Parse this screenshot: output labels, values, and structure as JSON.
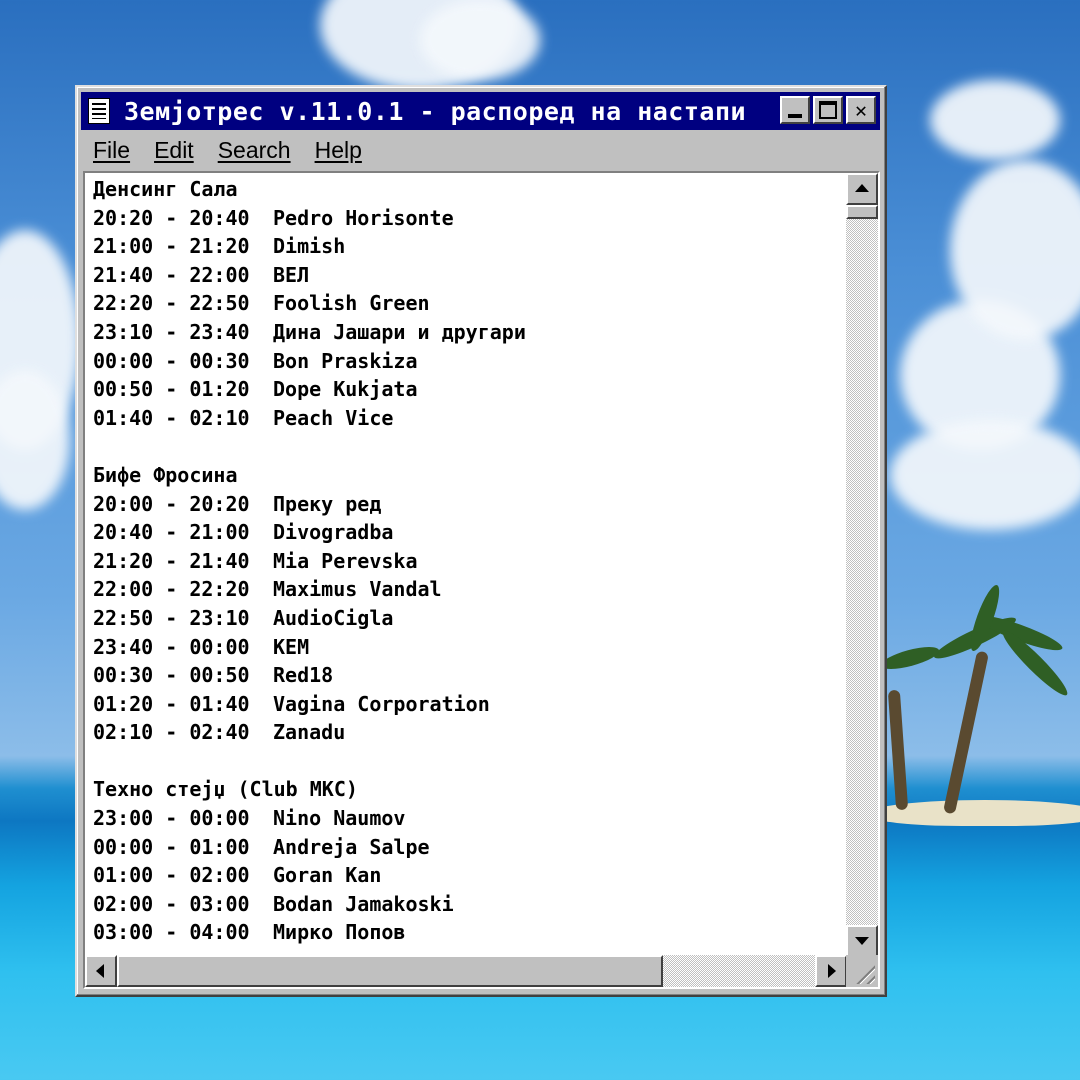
{
  "window": {
    "title": "Земјотрес v.11.0.1 - распоред на настапи"
  },
  "menu": [
    "File",
    "Edit",
    "Search",
    "Help"
  ],
  "content": {
    "lines": [
      {
        "text": "Денсинг Сала"
      },
      {
        "time": "20:20 - 20:40",
        "act": "Pedro Horisonte"
      },
      {
        "time": "21:00 - 21:20",
        "act": "Dimish"
      },
      {
        "time": "21:40 - 22:00",
        "act": "ВЕЛ"
      },
      {
        "time": "22:20 - 22:50",
        "act": "Foolish Green"
      },
      {
        "time": "23:10 - 23:40",
        "act": "Дина Јашари и другари"
      },
      {
        "time": "00:00 - 00:30",
        "act": "Bon Praskiza"
      },
      {
        "time": "00:50 - 01:20",
        "act": "Dope Kukjata"
      },
      {
        "time": "01:40 - 02:10",
        "act": "Peach Vice"
      },
      {
        "text": ""
      },
      {
        "text": "Бифе Фросина"
      },
      {
        "time": "20:00 - 20:20",
        "act": "Преку ред"
      },
      {
        "time": "20:40 - 21:00",
        "act": "Divogradba"
      },
      {
        "time": "21:20 - 21:40",
        "act": "Mia Perevska"
      },
      {
        "time": "22:00 - 22:20",
        "act": "Maximus Vandal"
      },
      {
        "time": "22:50 - 23:10",
        "act": "AudioCigla"
      },
      {
        "time": "23:40 - 00:00",
        "act": "KEM"
      },
      {
        "time": "00:30 - 00:50",
        "act": "Red18"
      },
      {
        "time": "01:20 - 01:40",
        "act": "Vagina Corporation"
      },
      {
        "time": "02:10 - 02:40",
        "act": "Zanadu"
      },
      {
        "text": ""
      },
      {
        "text": "Техно стејџ (Club МКС)"
      },
      {
        "time": "23:00 - 00:00",
        "act": "Nino Naumov"
      },
      {
        "time": "00:00 - 01:00",
        "act": "Andreja Salpe"
      },
      {
        "time": "01:00 - 02:00",
        "act": "Goran Kan"
      },
      {
        "time": "02:00 - 03:00",
        "act": "Bodan Jamakoski"
      },
      {
        "time": "03:00 - 04:00",
        "act": "Мирко Попов"
      }
    ]
  },
  "icons": {
    "app": "notepad-icon",
    "minimize": "minimize-icon",
    "maximize": "maximize-icon",
    "close": "close-icon"
  },
  "colors": {
    "titlebar": "#000080",
    "chrome": "#c0c0c0"
  }
}
